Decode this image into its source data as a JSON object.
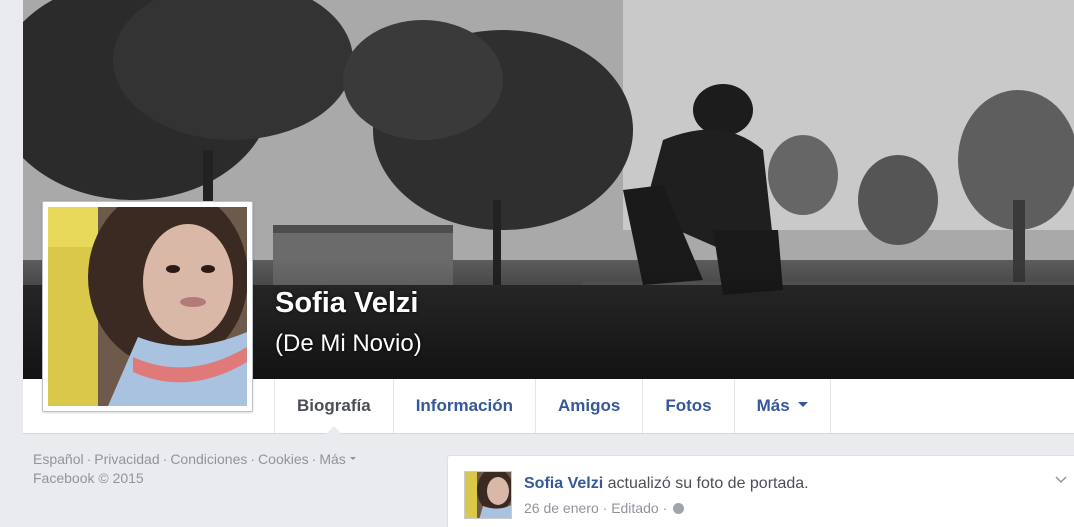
{
  "profile": {
    "name": "Sofia Velzi",
    "alternate_name": "(De Mi Novio)"
  },
  "tabs": [
    {
      "label": "Biografía",
      "active": true
    },
    {
      "label": "Información",
      "active": false
    },
    {
      "label": "Amigos",
      "active": false
    },
    {
      "label": "Fotos",
      "active": false
    },
    {
      "label": "Más",
      "active": false,
      "has_caret": true
    }
  ],
  "footer": {
    "links": [
      "Español",
      "Privacidad",
      "Condiciones",
      "Cookies",
      "Más"
    ],
    "copyright": "Facebook © 2015"
  },
  "story": {
    "author": "Sofia Velzi",
    "action": "actualizó su foto de portada.",
    "date": "26 de enero",
    "edited": "Editado",
    "privacy_icon": "globe-icon"
  },
  "colors": {
    "link_blue": "#365899",
    "text_dark": "#4b4f56",
    "text_muted": "#90949c",
    "page_bg": "#e9ebee"
  }
}
